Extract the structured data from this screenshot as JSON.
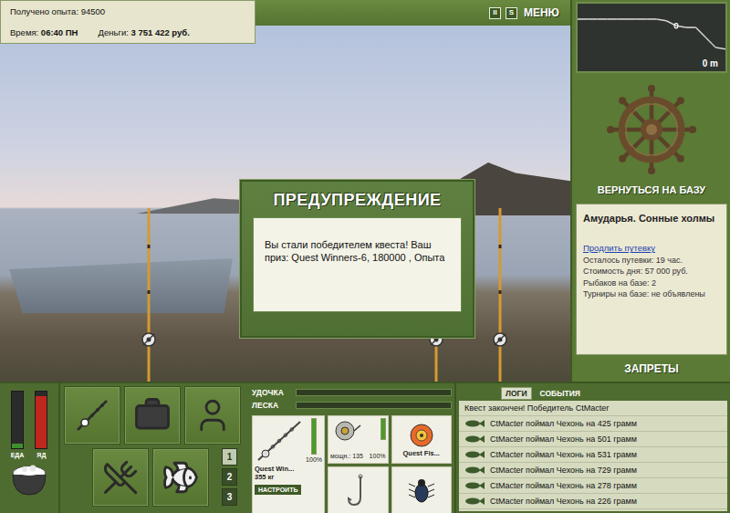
{
  "hud": {
    "experience_label": "Получено опыта:",
    "experience": "94500",
    "time_label": "Время:",
    "time": "06:40 ПН",
    "money_label": "Деньги:",
    "money": "3 751 422 руб."
  },
  "top_buttons": [
    {
      "label": "II",
      "kind": "pause"
    },
    {
      "label": "S",
      "kind": "sound"
    },
    {
      "label": "МЕНЮ",
      "kind": "menu"
    }
  ],
  "dialog": {
    "title": "ПРЕДУПРЕЖДЕНИЕ",
    "message": "Вы стали победителем квеста! Ваш приз: Quest Winners-6, 180000 , Опыта"
  },
  "depth_chart": {
    "reading": "0 m",
    "profile": [
      0.5,
      0.5,
      0.5,
      0.5,
      0.5,
      0.5,
      0.5,
      0.5,
      0.5,
      0.6,
      0.9,
      1.0,
      1.0,
      1.6,
      2.2,
      2.3
    ],
    "marker_index": 10
  },
  "return_button": "ВЕРНУТЬСЯ НА БАЗУ",
  "location": {
    "title": "Амударья. Сонные холмы",
    "extend_link": "Продлить путевку",
    "details": [
      "Осталось путевки: 19 час.",
      "Стоимость дня: 57 000 руб.",
      "Рыбаков на базе: 2",
      "Турниры на базе: не объявлены"
    ]
  },
  "bans_button": "ЗАПРЕТЫ",
  "meters": [
    {
      "label": "ЕДА",
      "level": 0.08,
      "color": "#3f8f2f"
    },
    {
      "label": "ЯД",
      "level": 0.92,
      "color": "#c0281e"
    }
  ],
  "rod_sets": [
    {
      "label": "1",
      "selected": true
    },
    {
      "label": "2",
      "selected": false
    },
    {
      "label": "3",
      "selected": false
    }
  ],
  "tension": [
    {
      "label": "УДОЧКА",
      "level": 0
    },
    {
      "label": "ЛЕСКА",
      "level": 0
    }
  ],
  "tackle": {
    "rod": {
      "name": "Quest Win...",
      "weight": "355 кг",
      "button": "НАСТРОИТЬ",
      "reading": "100%",
      "level": 1
    },
    "reel": {
      "power": "мощн.: 135",
      "reading": "100%",
      "level": 1
    },
    "lure": {
      "name": "Quest Fis..."
    }
  },
  "log": {
    "tabs": [
      {
        "label": "ЛОГИ",
        "selected": true
      },
      {
        "label": "СОБЫТИЯ",
        "selected": false
      }
    ],
    "entries": [
      {
        "kind": "notice",
        "text": "Квест закончен! Победитель CtMacter"
      },
      {
        "kind": "catch",
        "text": "CtMacter поймал Чехонь на 425 грамм"
      },
      {
        "kind": "catch",
        "text": "CtMacter поймал Чехонь на 501 грамм"
      },
      {
        "kind": "catch",
        "text": "CtMacter поймал Чехонь на 531 грамм"
      },
      {
        "kind": "catch",
        "text": "CtMacter поймал Чехонь на 729 грамм"
      },
      {
        "kind": "catch",
        "text": "CtMacter поймал Чехонь на 278 грамм"
      },
      {
        "kind": "catch",
        "text": "CtMacter поймал Чехонь на 226 грамм"
      }
    ]
  }
}
